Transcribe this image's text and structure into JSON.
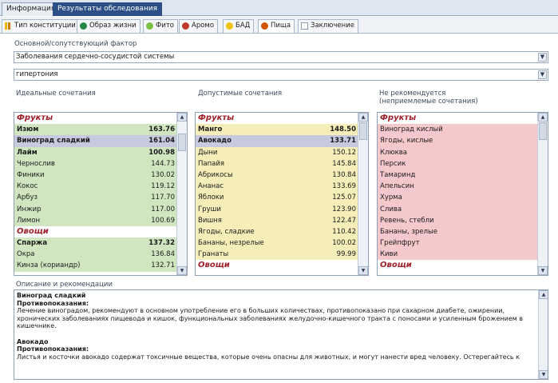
{
  "main_tabs": [
    "Информация",
    "Результаты обследования"
  ],
  "sub_tabs": [
    {
      "label": "Тип конституции",
      "icon": "constitution-icon",
      "color": "#e8a800"
    },
    {
      "label": "Образ жизни",
      "icon": "lifestyle-icon",
      "color": "#1f8a45"
    },
    {
      "label": "Фито",
      "icon": "herb-icon",
      "color": "#7ac142"
    },
    {
      "label": "Аромо",
      "icon": "aroma-icon",
      "color": "#c0392b"
    },
    {
      "label": "БАД",
      "icon": "supplement-icon",
      "color": "#f1c40f"
    },
    {
      "label": "Пища",
      "icon": "food-icon",
      "color": "#d35400"
    },
    {
      "label": "Заключение",
      "icon": "document-icon",
      "color": "#ffffff"
    }
  ],
  "factor_label": "Основной/сопутствующий фактор",
  "combo_1": "Заболевания сердечно-сосудистой системы",
  "combo_2": "гипертония",
  "col_headers": {
    "ideal": "Идеальные сочетания",
    "allowed": "Допустимые сочетания",
    "not_recommended": "Не рекомендуется\n(неприемлемые сочетания)"
  },
  "list_ideal": [
    {
      "text": "Фрукты",
      "type": "cat"
    },
    {
      "text": "Изюм",
      "value": "163.76",
      "bold": true
    },
    {
      "text": "Виноград сладкий",
      "value": "161.04",
      "bold": true,
      "selected": true
    },
    {
      "text": "Лайм",
      "value": "100.98",
      "bold": true
    },
    {
      "text": "Чернослив",
      "value": "144.73"
    },
    {
      "text": "Финики",
      "value": "130.02"
    },
    {
      "text": "Кокос",
      "value": "119.12"
    },
    {
      "text": "Арбуз",
      "value": "117.70"
    },
    {
      "text": "Инжир",
      "value": "117.00"
    },
    {
      "text": "Лимон",
      "value": "100.69"
    },
    {
      "text": "Овощи",
      "type": "cat"
    },
    {
      "text": "Спаржа",
      "value": "137.32",
      "bold": true
    },
    {
      "text": "Окра",
      "value": "136.84"
    },
    {
      "text": "Кинза (кориандр)",
      "value": "132.71"
    }
  ],
  "list_allowed": [
    {
      "text": "Фрукты",
      "type": "cat"
    },
    {
      "text": "Манго",
      "value": "148.50",
      "bold": true
    },
    {
      "text": "Авокадо",
      "value": "133.71",
      "bold": true,
      "selected": true
    },
    {
      "text": "Дыни",
      "value": "150.12"
    },
    {
      "text": "Папайя",
      "value": "145.84"
    },
    {
      "text": "Абрикосы",
      "value": "130.84"
    },
    {
      "text": "Ананас",
      "value": "133.69"
    },
    {
      "text": "Яблоки",
      "value": "125.07"
    },
    {
      "text": "Груши",
      "value": "123.90"
    },
    {
      "text": "Вишня",
      "value": "122.47"
    },
    {
      "text": "Ягоды, сладкие",
      "value": "110.42"
    },
    {
      "text": "Бананы, незрелые",
      "value": "100.02"
    },
    {
      "text": "Гранаты",
      "value": "99.99"
    },
    {
      "text": "Овощи",
      "type": "cat"
    }
  ],
  "list_not_recommended": [
    {
      "text": "Фрукты",
      "type": "cat"
    },
    {
      "text": "Виноград кислый"
    },
    {
      "text": "Ягоды, кислые"
    },
    {
      "text": "Клюква"
    },
    {
      "text": "Персик"
    },
    {
      "text": "Тамаринд"
    },
    {
      "text": "Апельсин"
    },
    {
      "text": "Хурма"
    },
    {
      "text": "Слива"
    },
    {
      "text": "Ревень, стебли"
    },
    {
      "text": "Бананы, зрелые"
    },
    {
      "text": "Грейпфрут"
    },
    {
      "text": "Киви"
    },
    {
      "text": "Овощи",
      "type": "cat"
    }
  ],
  "desc_label": "Описание и рекомендации",
  "description": [
    {
      "text": "Виноград сладкий",
      "h": true
    },
    {
      "text": "Противопоказания:",
      "h": true
    },
    {
      "text": "Лечение виноградом, рекомендуют в основном употребление его в больших количествах, противопоказано при сахарном диабете, ожирении, хронических заболеваниях пищевода и кишок, функциональных заболеваниях желудочно-кишечного тракта с поносами и усиленным брожением в кишечнике."
    },
    {
      "text": "",
      "spacer": true
    },
    {
      "text": "Авокадо",
      "h": true
    },
    {
      "text": "Противопоказания:",
      "h": true
    },
    {
      "text": "Листья и косточки авокадо содержат токсичные вещества, которые очень опасны для животных, и могут нанести вред человеку. Остерегайтесь к"
    }
  ],
  "colors": {
    "ideal_row": "#cfe6c1",
    "allowed_row": "#f5eeb9",
    "not_recommended_row": "#f5c8cb",
    "category_text": "#a0202a",
    "selected_row": "#c7cadf"
  }
}
